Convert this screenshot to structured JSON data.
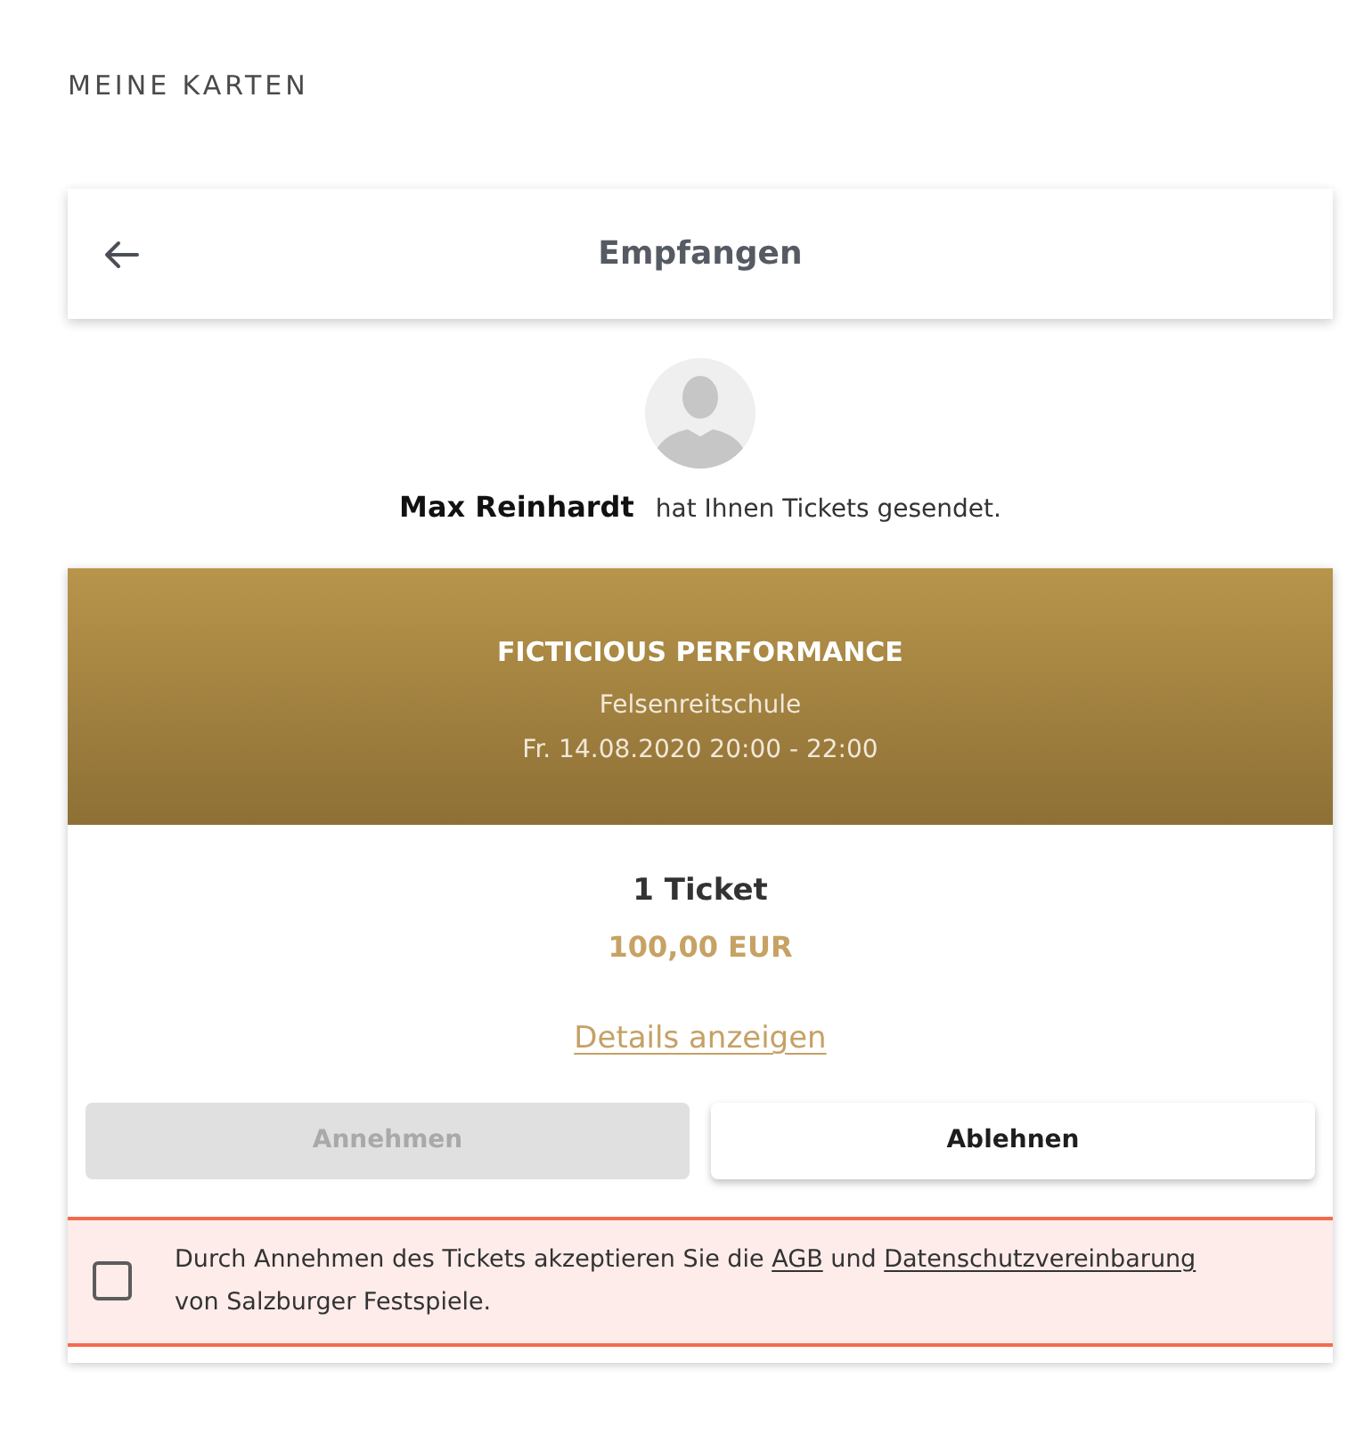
{
  "page_title": "MEINE KARTEN",
  "header": {
    "title": "Empfangen"
  },
  "sender": {
    "name": "Max Reinhardt",
    "message": "hat Ihnen Tickets gesendet."
  },
  "event": {
    "title": "FICTICIOUS PERFORMANCE",
    "venue": "Felsenreitschule",
    "datetime": "Fr. 14.08.2020 20:00 - 22:00"
  },
  "ticket": {
    "count": "1 Ticket",
    "price": "100,00 EUR",
    "details_link": "Details anzeigen"
  },
  "buttons": [
    {
      "label": "Annehmen",
      "disabled": true
    },
    {
      "label": "Ablehnen",
      "disabled": false
    }
  ],
  "consent": {
    "checked": false,
    "parts": [
      {
        "kind": "text",
        "text": "Durch Annehmen des Tickets akzeptieren Sie die"
      },
      {
        "kind": "link",
        "text": "AGB"
      },
      {
        "kind": "text",
        "text": "und"
      },
      {
        "kind": "link",
        "text": "Datenschutzvereinbarung"
      },
      {
        "kind": "text",
        "text": "von Salzburger Festspiele."
      }
    ]
  }
}
